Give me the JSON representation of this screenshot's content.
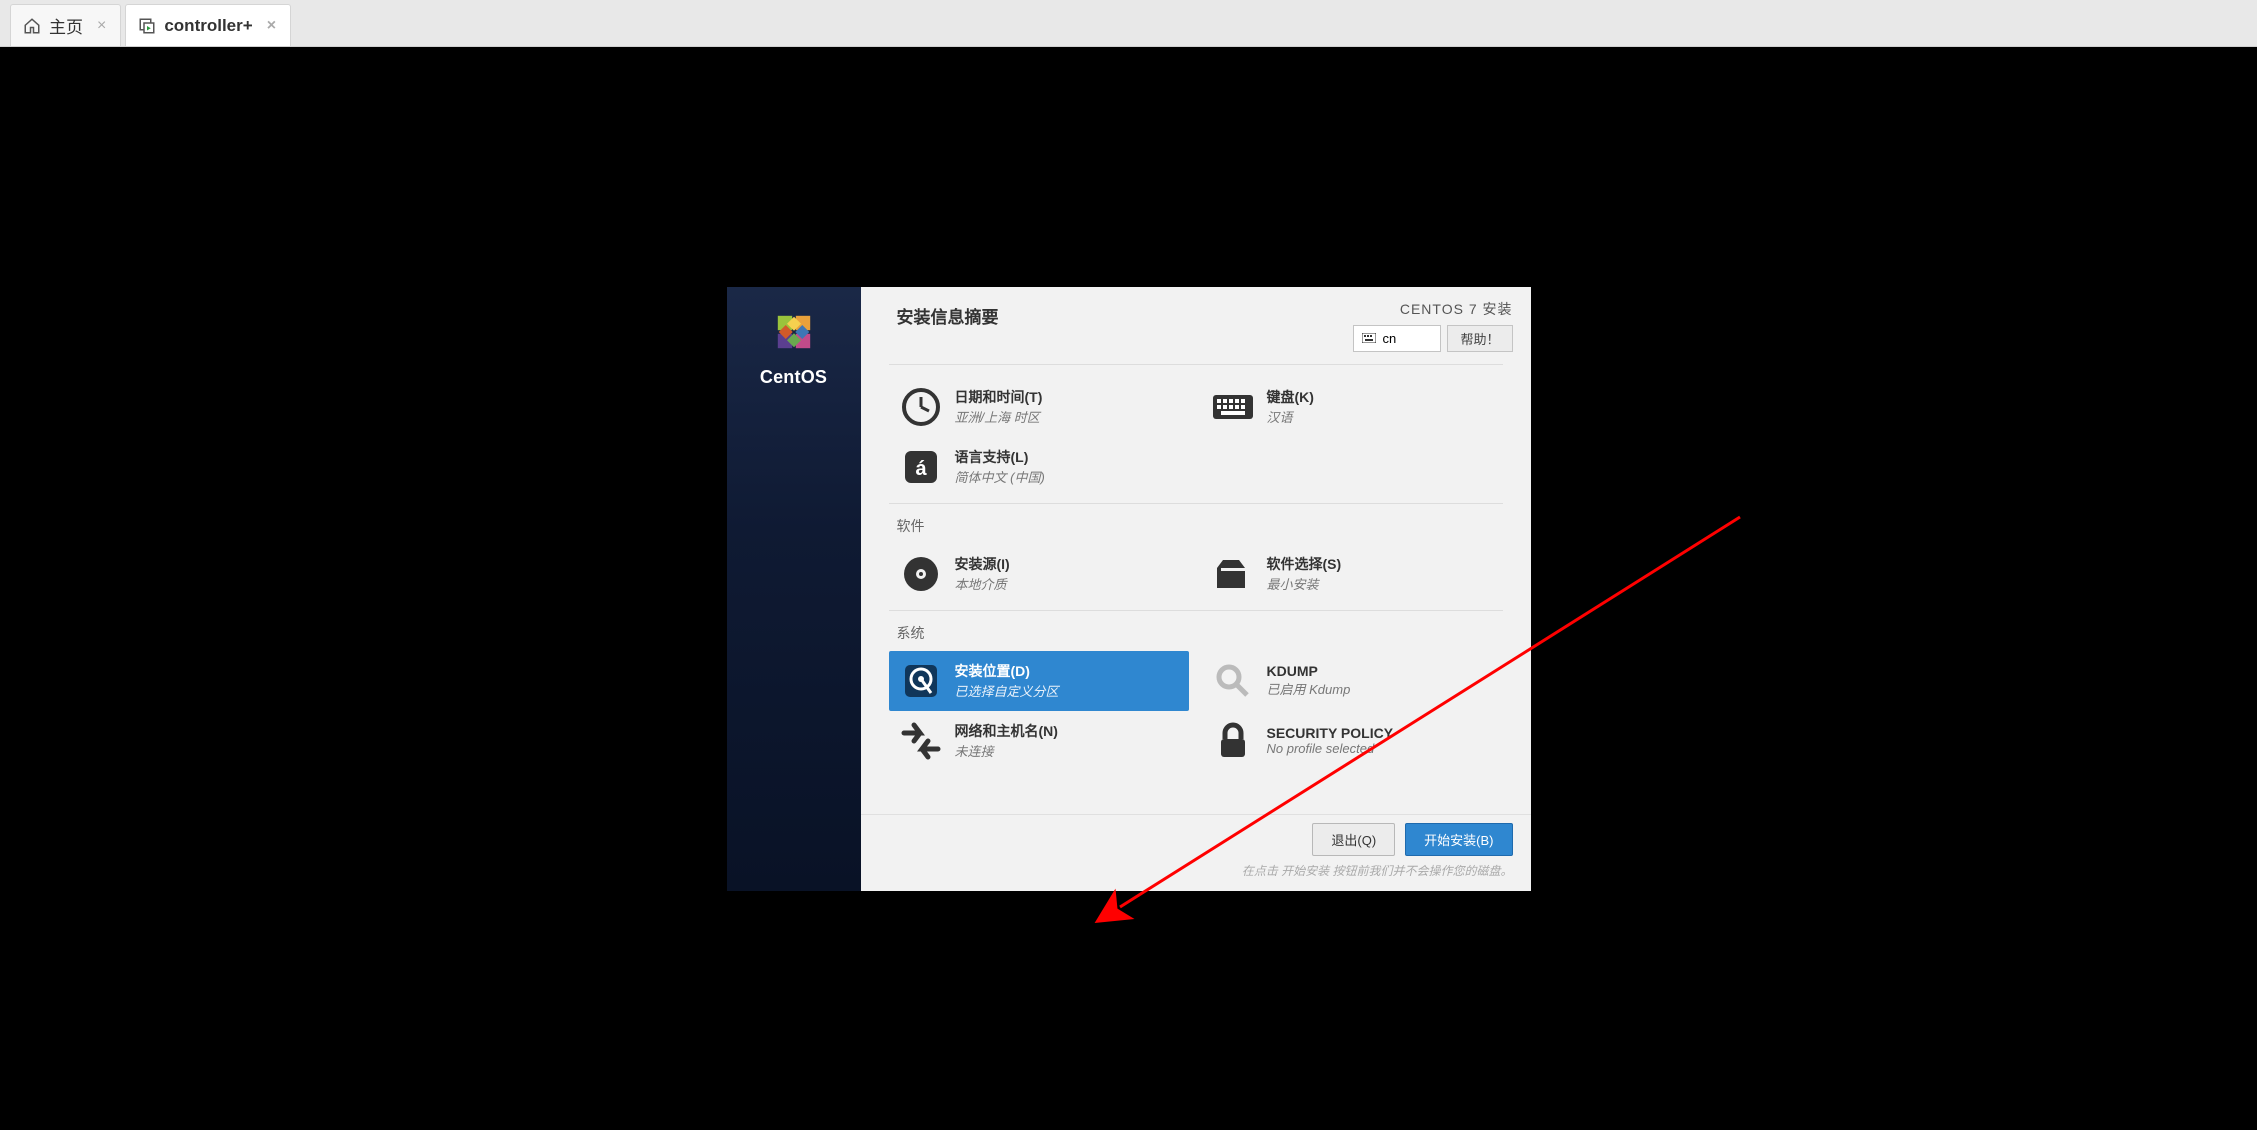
{
  "tabs": {
    "home": "主页",
    "controller": "controller+"
  },
  "sidebar": {
    "brand": "CentOS"
  },
  "header": {
    "title": "安装信息摘要",
    "product": "CENTOS 7 安装",
    "lang_code": "cn",
    "help": "帮助！"
  },
  "categories": {
    "localization": {
      "datetime": {
        "title": "日期和时间(T)",
        "status": "亚洲/上海 时区"
      },
      "keyboard": {
        "title": "键盘(K)",
        "status": "汉语"
      },
      "language": {
        "title": "语言支持(L)",
        "status": "简体中文 (中国)"
      }
    },
    "software": {
      "label": "软件",
      "source": {
        "title": "安装源(I)",
        "status": "本地介质"
      },
      "selection": {
        "title": "软件选择(S)",
        "status": "最小安装"
      }
    },
    "system": {
      "label": "系统",
      "destination": {
        "title": "安装位置(D)",
        "status": "已选择自定义分区"
      },
      "kdump": {
        "title": "KDUMP",
        "status": "已启用 Kdump"
      },
      "network": {
        "title": "网络和主机名(N)",
        "status": "未连接"
      },
      "security": {
        "title": "SECURITY POLICY",
        "status": "No profile selected"
      }
    }
  },
  "footer": {
    "quit": "退出(Q)",
    "begin": "开始安装(B)",
    "hint": "在点击 开始安装 按钮前我们并不会操作您的磁盘。"
  }
}
